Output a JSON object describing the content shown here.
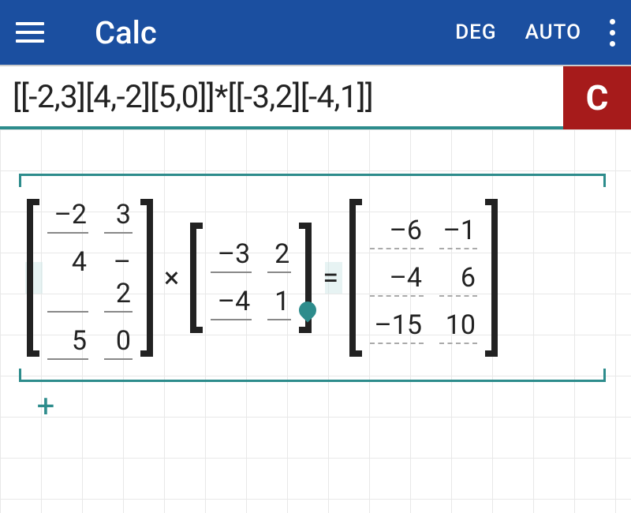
{
  "header": {
    "title": "Calc",
    "mode_angle": "DEG",
    "mode_precision": "AUTO"
  },
  "input": {
    "expression": "[[-2,3][4,-2][5,0]]*[[-3,2][-4,1]]",
    "clear_label": "C"
  },
  "equation": {
    "matrix_a": [
      [
        "–2",
        "3"
      ],
      [
        "4",
        "–2"
      ],
      [
        "5",
        "0"
      ]
    ],
    "op1": "×",
    "matrix_b": [
      [
        "–3",
        "2"
      ],
      [
        "–4",
        "1"
      ]
    ],
    "eq": "=",
    "matrix_c": [
      [
        "–6",
        "–1"
      ],
      [
        "–4",
        "6"
      ],
      [
        "–15",
        "10"
      ]
    ]
  },
  "controls": {
    "add_label": "+"
  }
}
